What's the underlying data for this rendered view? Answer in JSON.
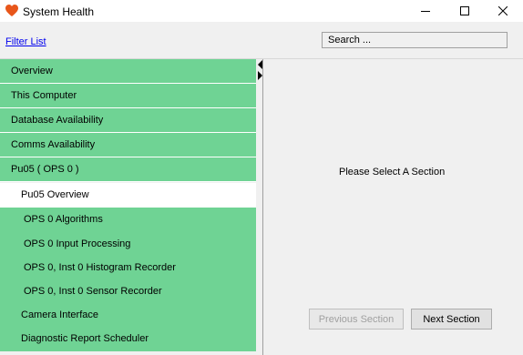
{
  "window": {
    "title": "System Health",
    "minimize_symbol": "—",
    "maximize_symbol": "☐",
    "close_symbol": "✕",
    "icon": "heart-icon",
    "icon_color": "#e8561a"
  },
  "toolbar": {
    "filter_link": "Filter List",
    "search_value": "Search ..."
  },
  "sidebar": {
    "accent_color": "#6fd394",
    "items": [
      {
        "label": "Overview"
      },
      {
        "label": "This Computer"
      },
      {
        "label": "Database Availability"
      },
      {
        "label": "Comms Availability"
      },
      {
        "label": "Pu05 ( OPS 0 )"
      },
      {
        "label": "Pu05 Overview",
        "selected": true
      },
      {
        "label": "OPS 0 Algorithms"
      },
      {
        "label": "OPS 0 Input Processing"
      },
      {
        "label": "OPS 0, Inst 0 Histogram Recorder"
      },
      {
        "label": "OPS 0, Inst 0 Sensor Recorder"
      },
      {
        "label": "Camera Interface"
      },
      {
        "label": "Diagnostic Report Scheduler"
      }
    ]
  },
  "content": {
    "placeholder": "Please Select A Section",
    "previous_button": "Previous Section",
    "next_button": "Next Section"
  }
}
